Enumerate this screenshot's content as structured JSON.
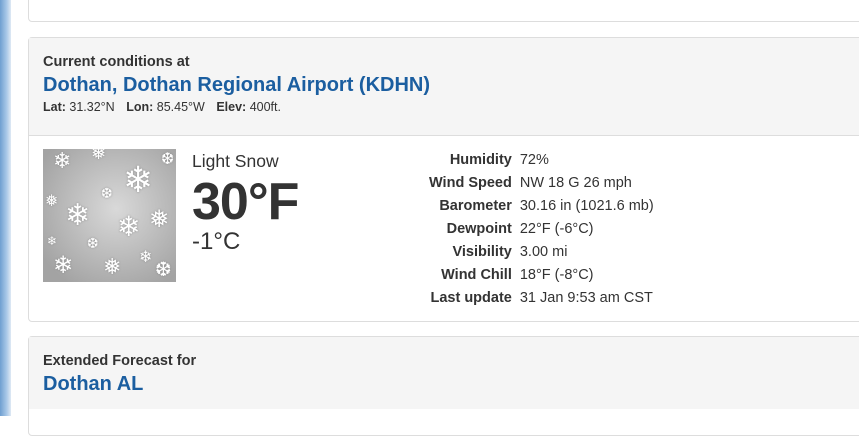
{
  "current": {
    "kicker": "Current conditions at",
    "location": "Dothan, Dothan Regional Airport (KDHN)",
    "lat_label": "Lat:",
    "lat": "31.32°N",
    "lon_label": "Lon:",
    "lon": "85.45°W",
    "elev_label": "Elev:",
    "elev": "400ft.",
    "condition": "Light Snow",
    "temp_f": "30°F",
    "temp_c": "-1°C",
    "icon": "light-snow-icon",
    "details": [
      {
        "label": "Humidity",
        "value": "72%"
      },
      {
        "label": "Wind Speed",
        "value": "NW 18 G 26 mph"
      },
      {
        "label": "Barometer",
        "value": "30.16 in (1021.6 mb)"
      },
      {
        "label": "Dewpoint",
        "value": "22°F (-6°C)"
      },
      {
        "label": "Visibility",
        "value": "3.00 mi"
      },
      {
        "label": "Wind Chill",
        "value": "18°F (-8°C)"
      },
      {
        "label": "Last update",
        "value": "31 Jan 9:53 am CST"
      }
    ]
  },
  "forecast": {
    "kicker": "Extended Forecast for",
    "location": "Dothan AL"
  },
  "colors": {
    "link": "#1b5ea0",
    "panel_header": "#f5f5f5",
    "border": "#dddddd"
  }
}
